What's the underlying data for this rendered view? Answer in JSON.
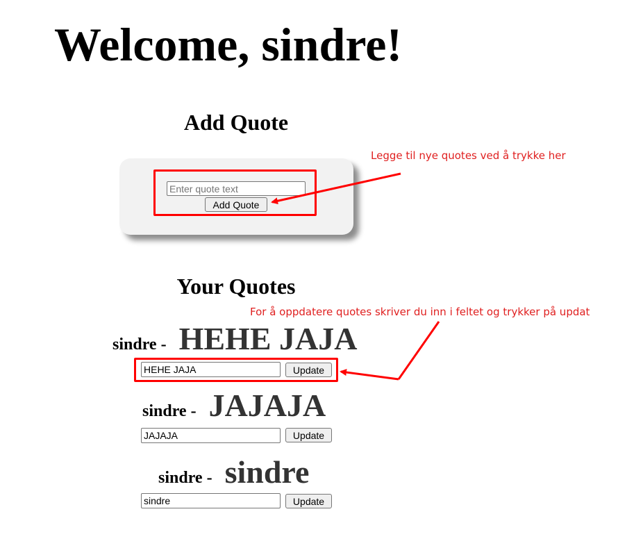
{
  "header": {
    "title": "Welcome, sindre!"
  },
  "add_quote": {
    "title": "Add Quote",
    "input_placeholder": "Enter quote text",
    "input_value": "",
    "button_label": "Add Quote"
  },
  "your_quotes": {
    "title": "Your Quotes",
    "separator": "-",
    "update_label": "Update",
    "items": [
      {
        "author": "sindre",
        "text": "HEHE JAJA",
        "input_value": "HEHE JAJA"
      },
      {
        "author": "sindre",
        "text": "JAJAJA",
        "input_value": "JAJAJA"
      },
      {
        "author": "sindre",
        "text": "sindre",
        "input_value": "sindre"
      }
    ]
  },
  "annotations": {
    "add_hint": "Legge til nye quotes ved å trykke her",
    "update_hint": "For å oppdatere quotes skriver du inn i feltet og trykker på updat"
  },
  "colors": {
    "annotation": "#e02020",
    "highlight_box": "#ff0000",
    "quote_text": "#333333",
    "card_background": "#f2f2f2"
  }
}
